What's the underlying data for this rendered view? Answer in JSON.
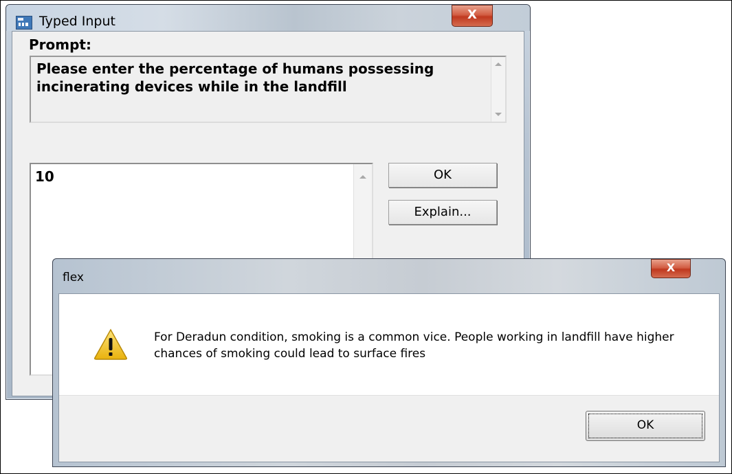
{
  "typed_input_window": {
    "title": "Typed Input",
    "close_label": "X",
    "prompt_label": "Prompt:",
    "prompt_text": "Please enter the percentage of humans possessing incinerating devices while in the landfill",
    "input_value": "10",
    "ok_label": "OK",
    "explain_label": "Explain..."
  },
  "flex_dialog": {
    "title": "flex",
    "close_label": "X",
    "message": "For Deradun condition, smoking is a common vice. People working in landfill have higher chances of smoking could lead to surface fires",
    "ok_label": "OK",
    "icon": "warning-icon"
  },
  "colors": {
    "close_button": "#c8432a",
    "warning_yellow": "#f2c318",
    "client_bg": "#f0f0f0"
  }
}
